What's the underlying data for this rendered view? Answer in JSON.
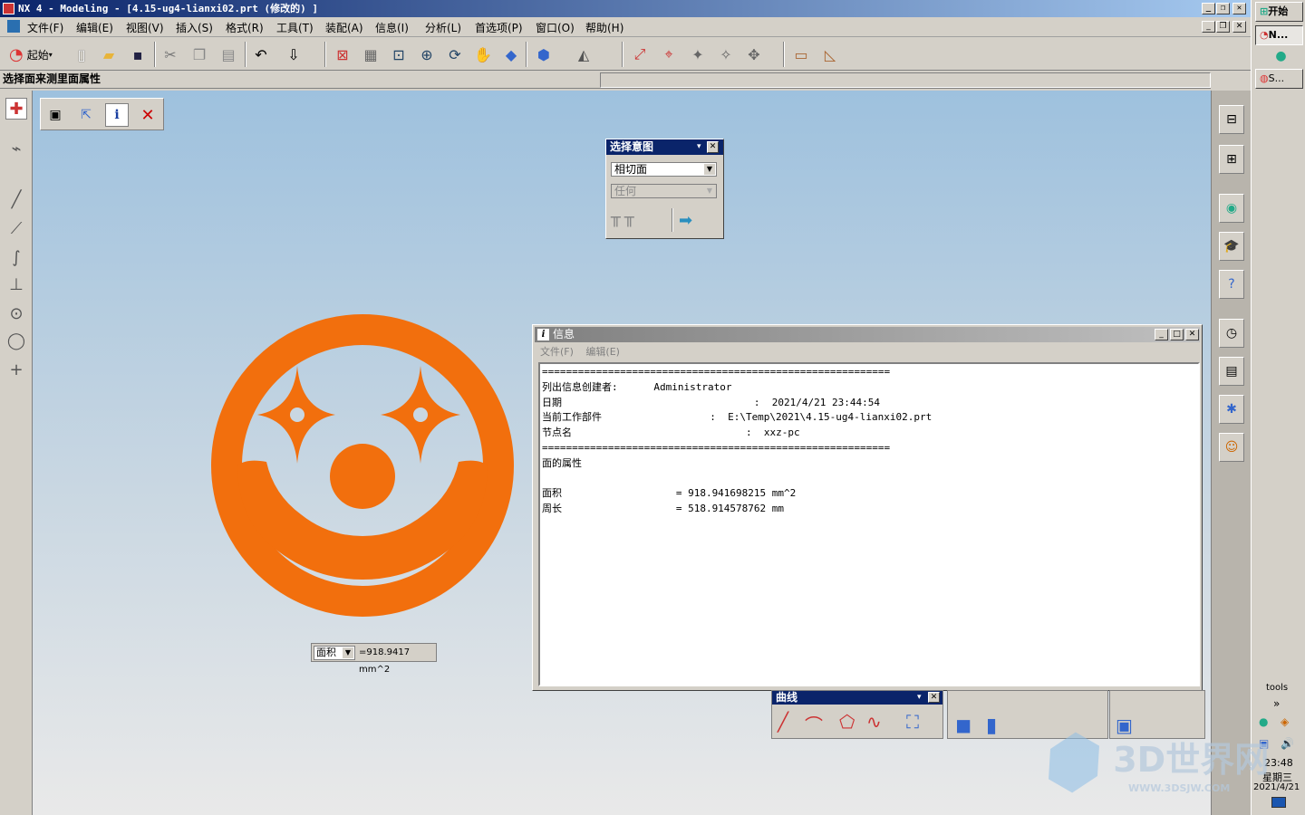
{
  "window": {
    "title": "NX 4 - Modeling - [4.15-ug4-lianxi02.prt  (修改的) ]"
  },
  "menu": [
    "文件(F)",
    "编辑(E)",
    "视图(V)",
    "插入(S)",
    "格式(R)",
    "工具(T)",
    "装配(A)",
    "信息(I)",
    "分析(L)",
    "首选项(P)",
    "窗口(O)",
    "帮助(H)"
  ],
  "toolbar": {
    "start_label": "起始"
  },
  "status": {
    "prompt": "选择面来测里面属性"
  },
  "select_intent": {
    "title": "选择意图",
    "rule": "相切面",
    "filter": "任何"
  },
  "info_window": {
    "title": "信息",
    "menu": [
      "文件(F)",
      "编辑(E)"
    ],
    "lines": [
      "==========================================================",
      "列出信息创建者:      Administrator",
      "日期                                :  2021/4/21 23:44:54",
      "当前工作部件                  :  E:\\Temp\\2021\\4.15-ug4-lianxi02.prt",
      "节点名                             :  xxz-pc",
      "==========================================================",
      "面的属性",
      "",
      "面积                   = 918.941698215 mm^2",
      "周长                   = 518.914578762 mm"
    ]
  },
  "readout": {
    "label": "面积",
    "value": "=918.9417 mm^2"
  },
  "curve_toolbar": {
    "title": "曲线"
  },
  "taskbar": {
    "start_label": "开始",
    "tasks": [
      "N...",
      "S..."
    ],
    "tools_label": "tools",
    "more": "»",
    "clock_time": "23:48",
    "clock_day": "星期三",
    "clock_date": "2021/4/21"
  },
  "watermark": {
    "text": "3D世界网",
    "sub": "WWW.3DSJW.COM"
  },
  "colors": {
    "clown_orange": "#f26f0d",
    "title_blue": "#0a246a"
  }
}
